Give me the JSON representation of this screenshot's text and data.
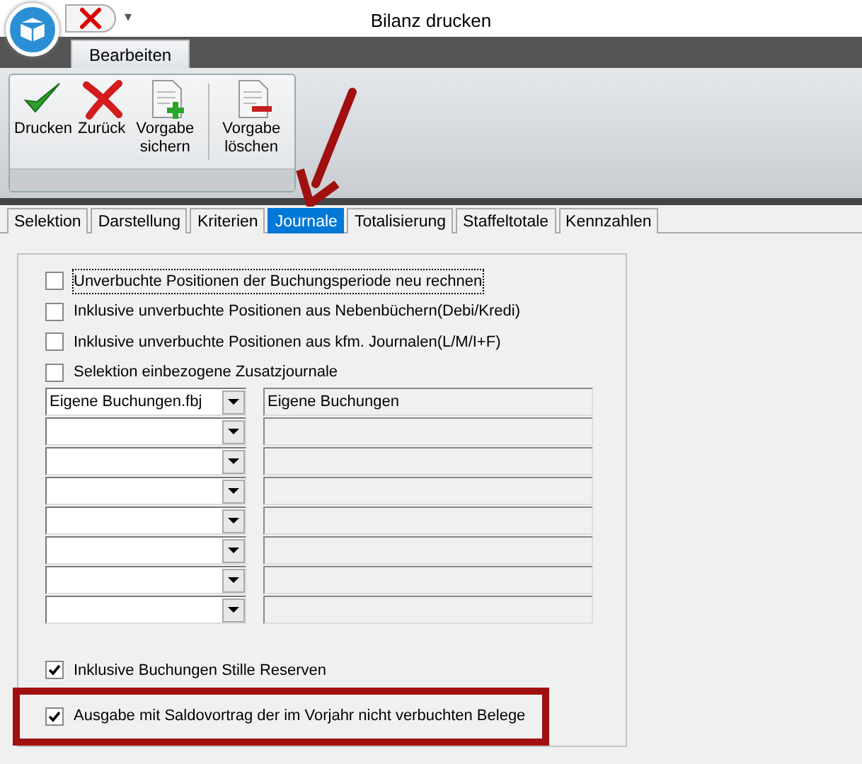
{
  "window": {
    "title": "Bilanz drucken"
  },
  "quick_access": {
    "menu_glyph": "▾"
  },
  "ribbon": {
    "tabs": [
      {
        "label": "Bearbeiten",
        "selected": true
      }
    ],
    "buttons": [
      {
        "kind": "check",
        "label": "Drucken"
      },
      {
        "kind": "cross",
        "label": "Zurück"
      },
      {
        "kind": "doc-plus",
        "label": "Vorgabe sichern"
      },
      {
        "kind": "separator"
      },
      {
        "kind": "doc-minus",
        "label": "Vorgabe löschen"
      }
    ]
  },
  "tabs": [
    {
      "label": "Selektion",
      "selected": false
    },
    {
      "label": "Darstellung",
      "selected": false
    },
    {
      "label": "Kriterien",
      "selected": false
    },
    {
      "label": "Journale",
      "selected": true
    },
    {
      "label": "Totalisierung",
      "selected": false
    },
    {
      "label": "Staffeltotale",
      "selected": false
    },
    {
      "label": "Kennzahlen",
      "selected": false
    }
  ],
  "options_top": [
    {
      "label": "Unverbuchte Positionen der Buchungsperiode neu rechnen",
      "checked": false,
      "focused": true
    },
    {
      "label": "Inklusive unverbuchte Positionen aus Nebenbüchern(Debi/Kredi)",
      "checked": false,
      "focused": false
    },
    {
      "label": "Inklusive unverbuchte Positionen aus kfm. Journalen(L/M/I+F)",
      "checked": false,
      "focused": false
    },
    {
      "label": "Selektion einbezogene Zusatzjournale",
      "checked": false,
      "focused": false
    }
  ],
  "journals": [
    {
      "kind": "filled",
      "file": "Eigene Buchungen.fbj",
      "name": "Eigene Buchungen"
    },
    {
      "kind": "empty"
    },
    {
      "kind": "empty"
    },
    {
      "kind": "empty"
    },
    {
      "kind": "empty"
    },
    {
      "kind": "empty"
    },
    {
      "kind": "empty"
    },
    {
      "kind": "empty"
    }
  ],
  "options_bottom": [
    {
      "label": "Inklusive Buchungen Stille Reserven",
      "checked": true,
      "highlighted": false
    },
    {
      "label": "Ausgabe mit Saldovortrag der im Vorjahr nicht verbuchten Belege",
      "checked": true,
      "highlighted": true
    }
  ],
  "annotation": {
    "arrow_to_selected_tab": true
  }
}
